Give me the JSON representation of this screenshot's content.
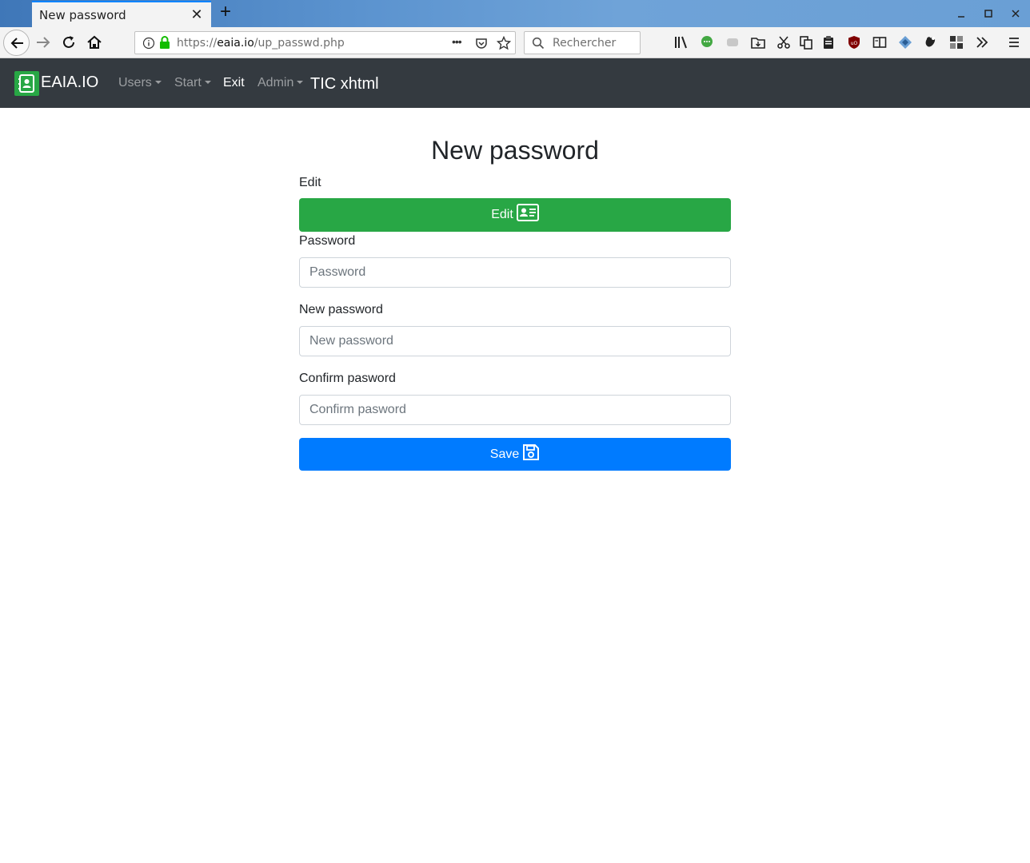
{
  "browser": {
    "tab_title": "New password",
    "tab_close": "✕",
    "new_tab": "+",
    "url_prefix": "https://",
    "url_host": "eaia.io",
    "url_path": "/up_passwd.php",
    "search_placeholder": "Rechercher",
    "url_more": "•••"
  },
  "site": {
    "brand": "EAIA.IO",
    "nav": {
      "users": "Users",
      "start": "Start",
      "exit": "Exit",
      "admin": "Admin",
      "title": "TIC xhtml"
    }
  },
  "form": {
    "title": "New password",
    "edit_label": "Edit",
    "edit_button": "Edit",
    "password_label": "Password",
    "password_placeholder": "Password",
    "new_password_label": "New password",
    "new_password_placeholder": "New password",
    "confirm_label": "Confirm pasword",
    "confirm_placeholder": "Confirm pasword",
    "save_button": "Save"
  },
  "colors": {
    "navbar_bg": "#343a40",
    "success": "#28a745",
    "primary": "#007bff"
  }
}
